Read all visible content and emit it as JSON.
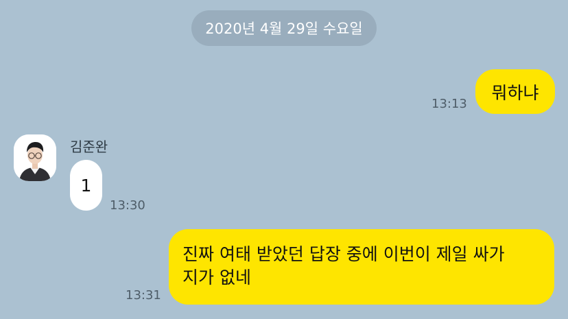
{
  "date_divider": "2020년 4월 29일 수요일",
  "messages": [
    {
      "sender": "me",
      "text": "뭐하냐",
      "time": "13:13"
    },
    {
      "sender": "김준완",
      "text": "1",
      "time": "13:30"
    },
    {
      "sender": "me",
      "line1": "진짜 여태 받았던 답장 중에 이번이 제일 싸가",
      "line2": "지가 없네",
      "time": "13:31"
    }
  ],
  "colors": {
    "background": "#abc1d1",
    "my_bubble": "#fee500",
    "their_bubble": "#ffffff"
  },
  "icons": {
    "avatar": "profile-photo"
  }
}
